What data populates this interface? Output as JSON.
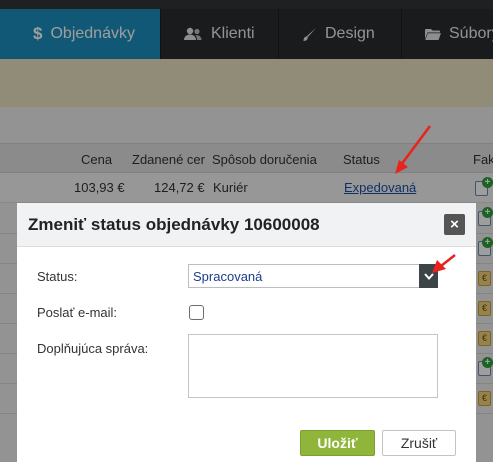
{
  "nav": {
    "tabs": [
      {
        "label": "Objednávky",
        "icon": "dollar-icon",
        "active": true
      },
      {
        "label": "Klienti",
        "icon": "users-icon",
        "active": false
      },
      {
        "label": "Design",
        "icon": "brush-icon",
        "active": false
      },
      {
        "label": "Súbory",
        "icon": "folder-icon",
        "active": false
      }
    ]
  },
  "table": {
    "headers": [
      "Cena",
      "Zdanené cer",
      "Spôsob doručenia",
      "Status",
      "Fak"
    ],
    "first_row": {
      "price": "103,93 €",
      "price_taxed": "124,72 €",
      "delivery": "Kuriér",
      "status": "Expedovaná"
    }
  },
  "modal": {
    "title": "Zmeniť status objednávky 10600008",
    "status_label": "Status:",
    "status_value": "Spracovaná",
    "email_label": "Poslať e-mail:",
    "message_label": "Doplňujúca správa:",
    "message_value": "",
    "save_label": "Uložiť",
    "cancel_label": "Zrušiť",
    "close_symbol": "×"
  },
  "colors": {
    "active_tab": "#1a8fbe",
    "save_button": "#8fb53a",
    "annotation_arrow": "#e8231b",
    "link": "#1a4fa8"
  }
}
